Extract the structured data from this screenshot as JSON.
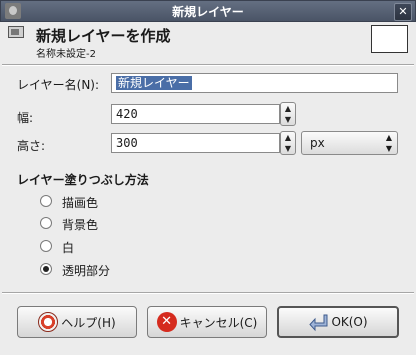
{
  "window": {
    "title": "新規レイヤー",
    "close_glyph": "✕"
  },
  "header": {
    "title": "新規レイヤーを作成",
    "subtitle": "名称未設定-2"
  },
  "form": {
    "name_label": "レイヤー名(N):",
    "name_value": "新規レイヤー",
    "width_label": "幅:",
    "width_value": "420",
    "height_label": "高さ:",
    "height_value": "300",
    "unit_value": "px"
  },
  "fill": {
    "title": "レイヤー塗りつぶし方法",
    "options": [
      {
        "label": "描画色",
        "selected": false
      },
      {
        "label": "背景色",
        "selected": false
      },
      {
        "label": "白",
        "selected": false
      },
      {
        "label": "透明部分",
        "selected": true
      }
    ]
  },
  "buttons": {
    "help": "ヘルプ(H)",
    "cancel": "キャンセル(C)",
    "ok": "OK(O)"
  },
  "icons": {
    "app": "gimp-app-icon",
    "close": "close-icon",
    "header": "layer-icon",
    "help": "lifebuoy-icon",
    "cancel": "cancel-icon",
    "ok": "enter-arrow-icon"
  },
  "colors": {
    "titlebar": "#525c6e",
    "selection": "#4a6ea7",
    "cancel": "#d52b1e"
  }
}
